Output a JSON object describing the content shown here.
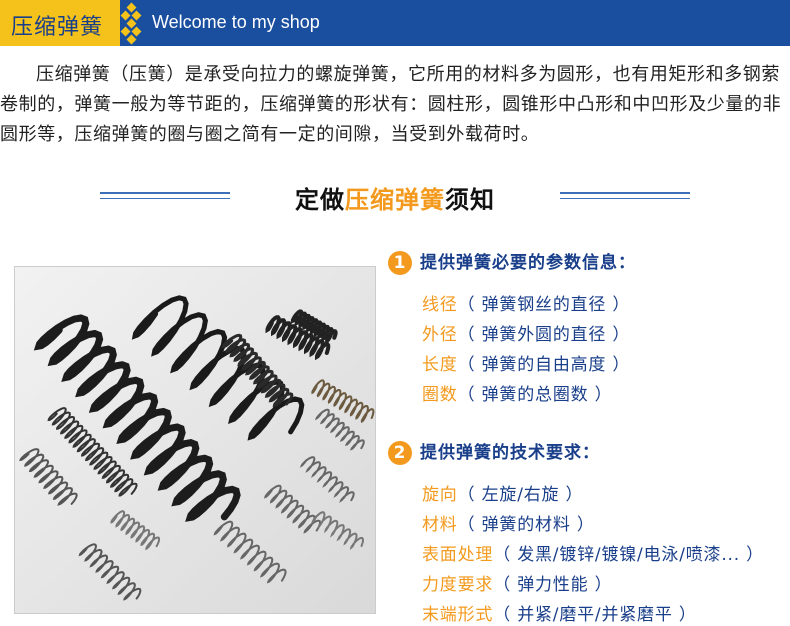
{
  "header": {
    "tag": "压缩弹簧",
    "welcome": "Welcome to my shop"
  },
  "intro": "压缩弹簧（压簧）是承受向拉力的螺旋弹簧，它所用的材料多为圆形，也有用矩形和多钢萦卷制的，弹簧一般为等节距的，压缩弹簧的形状有：圆柱形，圆锥形中凸形和中凹形及少量的非圆形等，压缩弹簧的圈与圈之简有一定的间隙，当受到外载荷时。",
  "section_title": {
    "pre": "定做",
    "highlight": "压缩弹簧",
    "post": "须知"
  },
  "section1": {
    "num": "1",
    "heading": "提供弹簧必要的参数信息：",
    "items": [
      {
        "label": "线径",
        "value": "（ 弹簧钢丝的直径 ）"
      },
      {
        "label": "外径",
        "value": "（ 弹簧外圆的直径 ）"
      },
      {
        "label": "长度",
        "value": "（ 弹簧的自由高度 ）"
      },
      {
        "label": "圈数",
        "value": "（ 弹簧的总圈数 ）"
      }
    ]
  },
  "section2": {
    "num": "2",
    "heading": "提供弹簧的技术要求：",
    "items": [
      {
        "label": "旋向",
        "value": "（ 左旋/右旋 ）"
      },
      {
        "label": "材料",
        "value": "（ 弹簧的材料 ）"
      },
      {
        "label": "表面处理",
        "value": "（ 发黑/镀锌/镀镍/电泳/喷漆... ）"
      },
      {
        "label": "力度要求",
        "value": "（ 弹力性能 ）"
      },
      {
        "label": "末端形式",
        "value": "（ 并紧/磨平/并紧磨平 ）"
      }
    ]
  },
  "colors": {
    "brand_blue": "#1a4fa0",
    "accent_yellow": "#f4c21a",
    "accent_orange": "#f39a1e",
    "text_blue": "#1a3f8a"
  },
  "photo_icon": "compression-springs-photo"
}
